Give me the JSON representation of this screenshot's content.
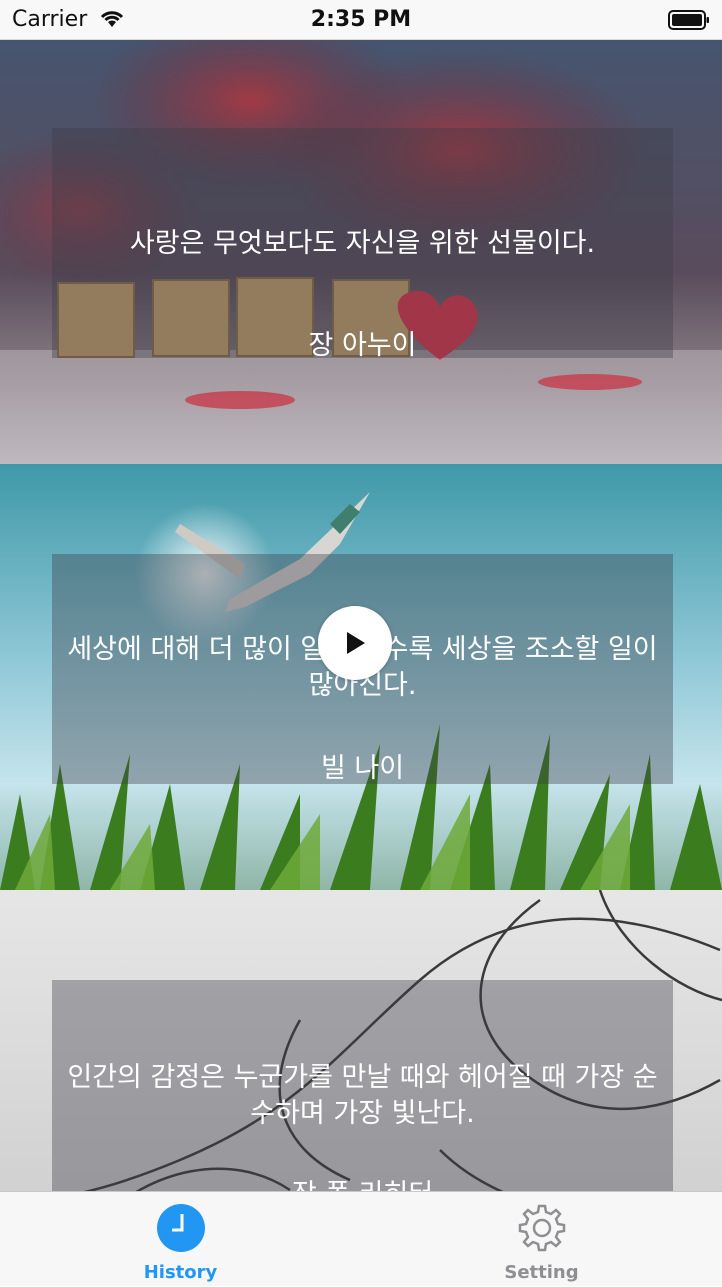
{
  "status_bar": {
    "carrier": "Carrier",
    "time": "2:35 PM"
  },
  "cards": [
    {
      "quote": "사랑은 무엇보다도 자신을 위한 선물이다.",
      "author": "장 아누이"
    },
    {
      "quote": "세상에 대해 더 많이 알면 알수록 세상을 조소할 일이 많아진다.",
      "author": "빌 나이"
    },
    {
      "quote": "인간의 감정은 누군가를 만날 때와 헤어질 때 가장 순수하며 가장 빛난다.",
      "author": "장 폴 리히터"
    }
  ],
  "tabs": [
    {
      "label": "History",
      "icon": "clock-icon",
      "active": true
    },
    {
      "label": "Setting",
      "icon": "gear-icon",
      "active": false
    }
  ],
  "colors": {
    "active_tab": "#2196f3",
    "inactive_tab": "#8e8e93"
  }
}
